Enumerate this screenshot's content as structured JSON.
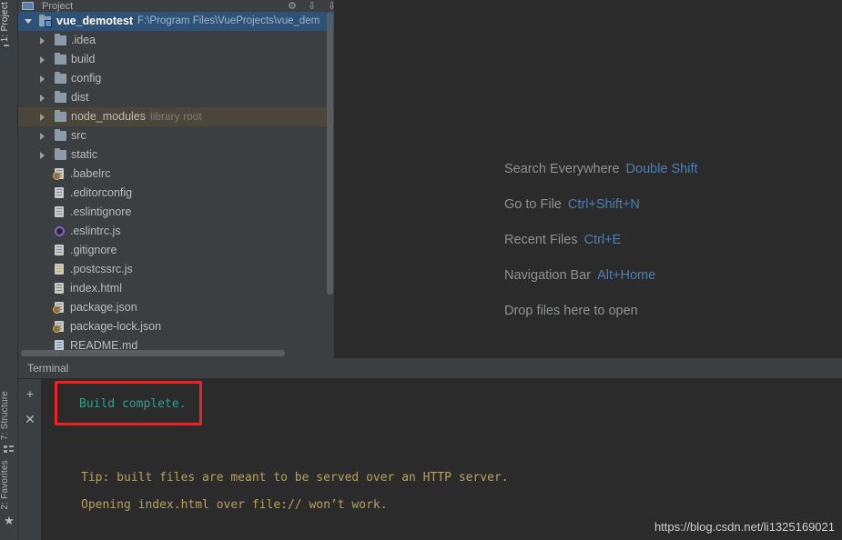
{
  "rail": {
    "tabs": [
      {
        "label": "1: Project",
        "icon": "project-folder-icon",
        "active": true
      },
      {
        "label": "7: Structure",
        "icon": "structure-icon",
        "active": false
      },
      {
        "label": "2: Favorites",
        "icon": "star-icon",
        "active": false
      }
    ]
  },
  "project_panel": {
    "toolbar": {
      "title": "Project",
      "icons": [
        "project-view-icon",
        "gear-icon",
        "collapse-all-icon",
        "hide-icon"
      ]
    },
    "tree": [
      {
        "name": "vue_demotest",
        "type": "project-root",
        "indent": 0,
        "expanded": true,
        "selected": true,
        "path": "F:\\Program Files\\VueProjects\\vue_dem"
      },
      {
        "name": ".idea",
        "type": "folder",
        "indent": 1,
        "expanded": false
      },
      {
        "name": "build",
        "type": "folder",
        "indent": 1,
        "expanded": false
      },
      {
        "name": "config",
        "type": "folder",
        "indent": 1,
        "expanded": false
      },
      {
        "name": "dist",
        "type": "folder",
        "indent": 1,
        "expanded": false
      },
      {
        "name": "node_modules",
        "type": "folder",
        "indent": 1,
        "expanded": false,
        "tag": "library root",
        "highlight": true
      },
      {
        "name": "src",
        "type": "folder",
        "indent": 1,
        "expanded": false
      },
      {
        "name": "static",
        "type": "folder",
        "indent": 1,
        "expanded": false
      },
      {
        "name": ".babelrc",
        "type": "file-json",
        "indent": 2
      },
      {
        "name": ".editorconfig",
        "type": "file-text",
        "indent": 2
      },
      {
        "name": ".eslintignore",
        "type": "file-text",
        "indent": 2
      },
      {
        "name": ".eslintrc.js",
        "type": "file-js",
        "indent": 2
      },
      {
        "name": ".gitignore",
        "type": "file-text",
        "indent": 2
      },
      {
        "name": ".postcssrc.js",
        "type": "file-css",
        "indent": 2
      },
      {
        "name": "index.html",
        "type": "file-html",
        "indent": 2
      },
      {
        "name": "package.json",
        "type": "file-json",
        "indent": 2
      },
      {
        "name": "package-lock.json",
        "type": "file-json",
        "indent": 2
      },
      {
        "name": "README.md",
        "type": "file-md",
        "indent": 2
      }
    ]
  },
  "editor": {
    "hints": [
      {
        "label": "Search Everywhere",
        "key": "Double Shift"
      },
      {
        "label": "Go to File",
        "key": "Ctrl+Shift+N"
      },
      {
        "label": "Recent Files",
        "key": "Ctrl+E"
      },
      {
        "label": "Navigation Bar",
        "key": "Alt+Home"
      },
      {
        "label": "Drop files here to open",
        "key": ""
      }
    ]
  },
  "terminal": {
    "tab_label": "Terminal",
    "buttons": [
      {
        "name": "new-session",
        "glyph": "+"
      },
      {
        "name": "close-session",
        "glyph": "✕"
      }
    ],
    "lines": [
      {
        "text": "Build complete.",
        "color": "green",
        "highlighted": true
      },
      {
        "text": "Tip: built files are meant to be served over an HTTP server.",
        "color": "yellow"
      },
      {
        "text": "Opening index.html over file:// won’t work.",
        "color": "yellow"
      }
    ]
  },
  "watermark": "https://blog.csdn.net/li1325169021",
  "colors": {
    "panel_bg": "#3c3f41",
    "editor_bg": "#2b2b2b",
    "selection_blue": "#2e5277",
    "library_root": "#4b4639",
    "hint_key": "#4c7fb3",
    "terminal_green": "#2f9e8f",
    "terminal_yellow": "#b5a15c",
    "highlight_red": "#ee2222"
  }
}
